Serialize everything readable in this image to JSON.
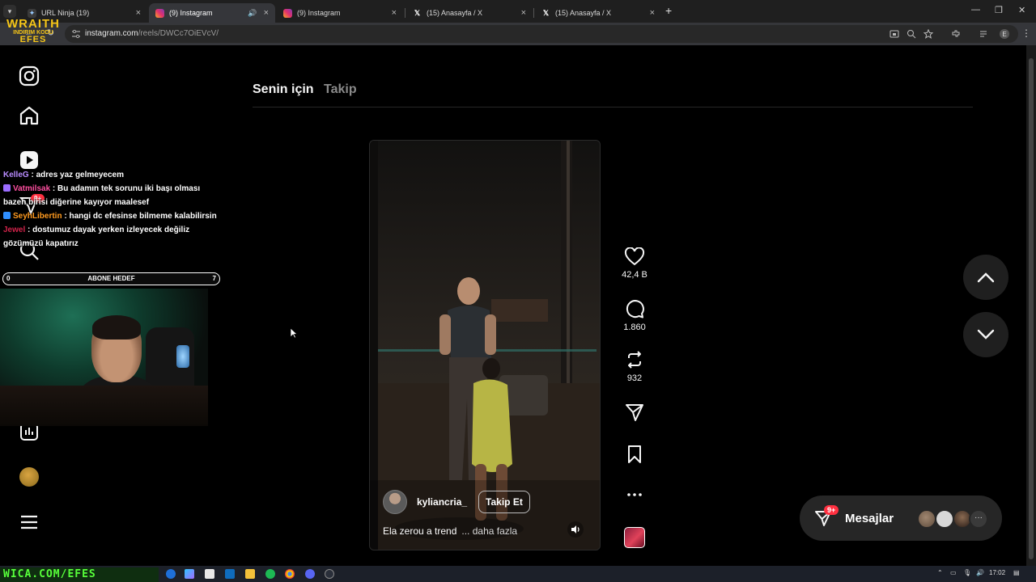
{
  "browser": {
    "tabs": [
      {
        "title": "URL Ninja (19)",
        "favicon": "url-ninja-icon",
        "active": false
      },
      {
        "title": "(9) Instagram",
        "favicon": "instagram-icon",
        "active": true
      },
      {
        "title": "(9) Instagram",
        "favicon": "instagram-icon",
        "active": false
      },
      {
        "title": "(15) Anasayfa / X",
        "favicon": "x-icon",
        "active": false
      },
      {
        "title": "(15) Anasayfa / X",
        "favicon": "x-icon",
        "active": false
      }
    ],
    "url_host": "instagram.com",
    "url_path": "/reels/DWCc7OiEVcV/",
    "profile_initial": "E"
  },
  "overlay": {
    "brand_top": "WRAITH",
    "brand_middle": "INDIRIM KODU",
    "brand_bottom": "EFES",
    "footer_text": "WICA.COM/EFES"
  },
  "sidebar": {
    "badge": "9+"
  },
  "feed": {
    "tab_for_you": "Senin için",
    "tab_following": "Takip"
  },
  "reel": {
    "username": "kyliancria_",
    "follow_label": "Takip Et",
    "caption": "Ela zerou a trend",
    "caption_more": "... daha fazla"
  },
  "actions": {
    "likes": "42,4 B",
    "comments": "1.860",
    "reposts": "932"
  },
  "messages": {
    "label": "Mesajlar",
    "badge": "9+"
  },
  "chat": [
    {
      "user": "KelleG",
      "text": " : adres yaz gelmeyecem",
      "color_class": "u1",
      "icon": ""
    },
    {
      "user": "Vatmilsak",
      "text": " : Bu adamın tek sorunu iki başı olması bazen birisi diğerine kayıyor maalesef",
      "color_class": "u2",
      "icon": "#9b6cff"
    },
    {
      "user": "SeyhLibertin",
      "text": " : hangi dc efesinse bilmeme kalabilirsin",
      "color_class": "u3",
      "icon": "#2f8fff"
    },
    {
      "user": "Jewel",
      "text": " : dostumuz dayak yerken izleyecek değiliz gözümüzü kapatırız",
      "color_class": "u4",
      "icon": ""
    }
  ],
  "goal": {
    "left": "0",
    "label": "ABONE HEDEF",
    "right": "7"
  },
  "taskbar": {
    "time": "17:02"
  },
  "colors": {
    "accent_badge": "#ff3040",
    "overlay_yellow": "#f5c518",
    "overlay_green": "#57ff3a"
  }
}
